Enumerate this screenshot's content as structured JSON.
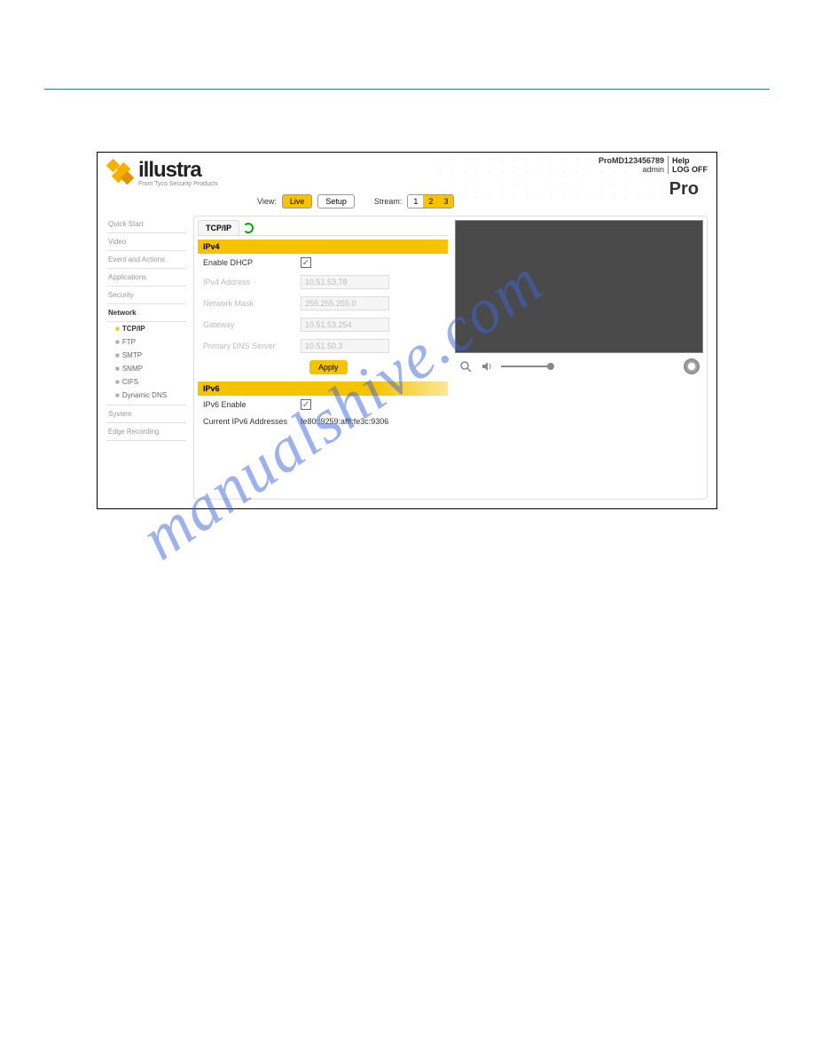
{
  "brand": "illustra",
  "tagline": "From Tyco Security Products",
  "header": {
    "device": "ProMD123456789",
    "user": "admin",
    "help": "Help",
    "logoff": "LOG OFF",
    "pro": "Pro"
  },
  "toolbar": {
    "view_label": "View:",
    "live": "Live",
    "setup": "Setup",
    "stream_label": "Stream:",
    "streams": [
      "1",
      "2",
      "3"
    ]
  },
  "sidebar": {
    "items": [
      "Quick Start",
      "Video",
      "Event and Actions",
      "Applications",
      "Security"
    ],
    "network_label": "Network",
    "network_subs": [
      "TCP/IP",
      "FTP",
      "SMTP",
      "SNMP",
      "CIFS",
      "Dynamic DNS"
    ],
    "after": [
      "System",
      "Edge Recording"
    ]
  },
  "tab": "TCP/IP",
  "ipv4": {
    "header": "IPv4",
    "enable_dhcp": "Enable DHCP",
    "addr_label": "IPv4 Address",
    "addr_val": "10.51.53.78",
    "mask_label": "Network Mask",
    "mask_val": "255.255.255.0",
    "gw_label": "Gateway",
    "gw_val": "10.51.53.254",
    "dns_label": "Primary DNS Server",
    "dns_val": "10.51.50.3",
    "apply": "Apply"
  },
  "ipv6": {
    "header": "IPv6",
    "enable": "IPv6 Enable",
    "cur_label": "Current IPv6 Addresses",
    "cur_val": "fe80::9259:afff:fe3c:9306"
  },
  "watermark": "manualshive.com"
}
